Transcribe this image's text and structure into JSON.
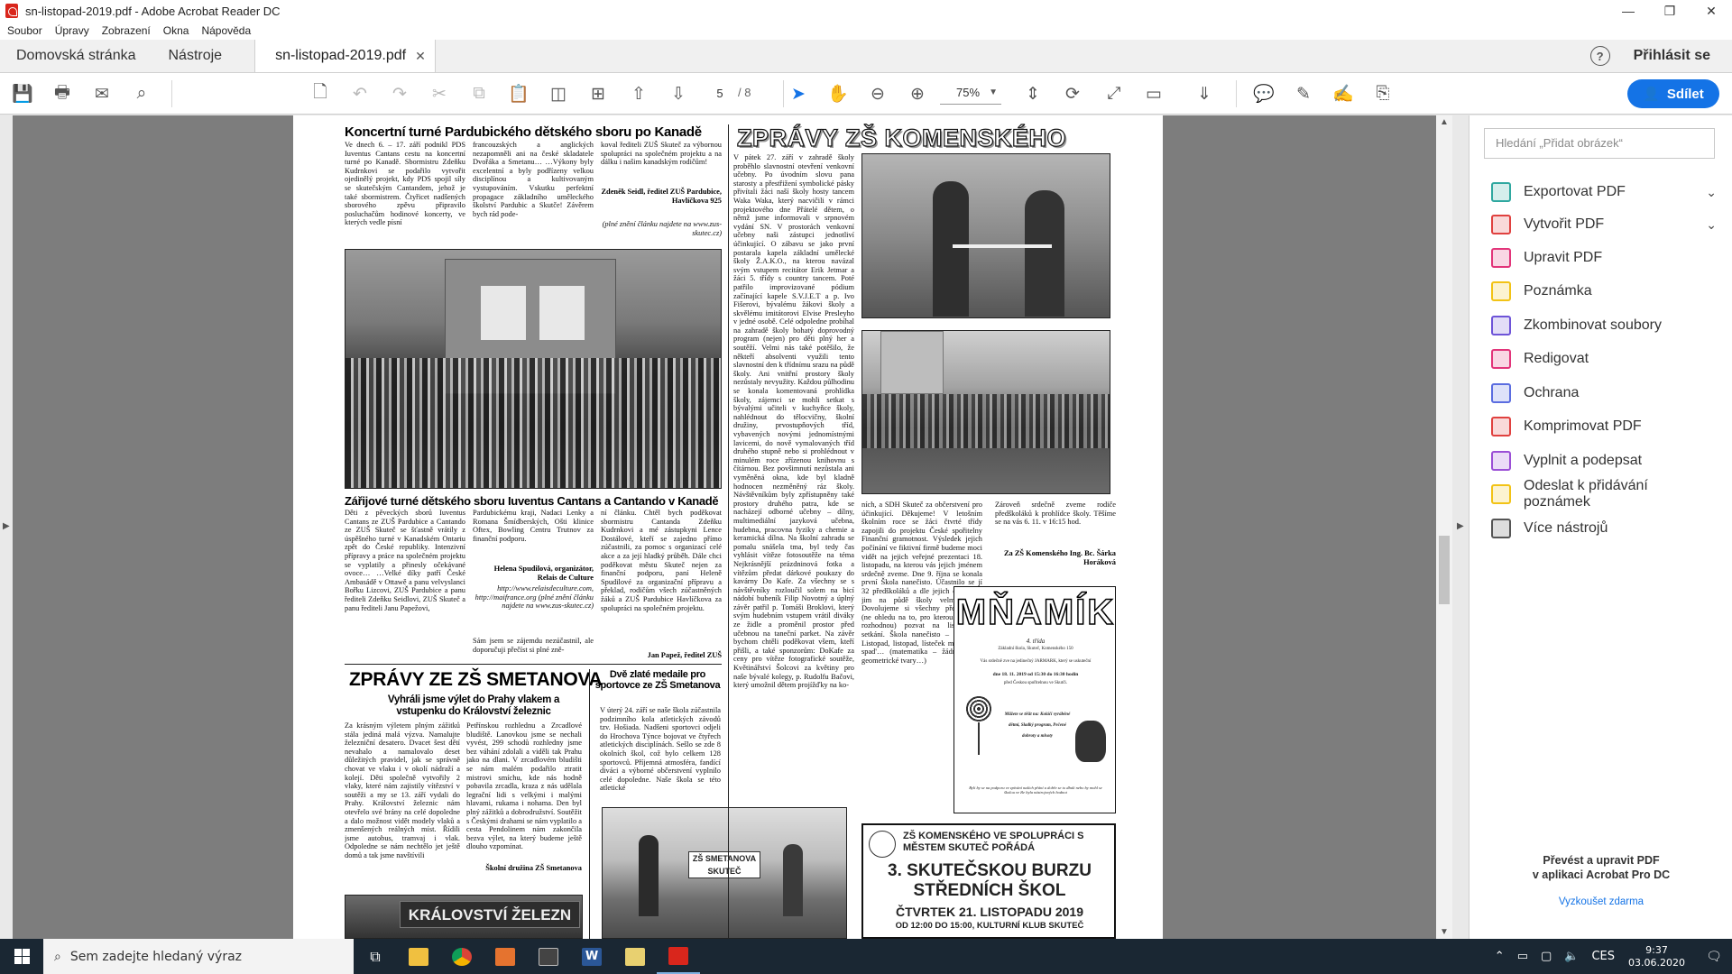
{
  "window": {
    "title": "sn-listopad-2019.pdf - Adobe Acrobat Reader DC",
    "minimize": "—",
    "maximize": "❐",
    "close": "✕"
  },
  "menu": [
    "Soubor",
    "Úpravy",
    "Zobrazení",
    "Okna",
    "Nápověda"
  ],
  "tabs": {
    "home": "Domovská stránka",
    "tools": "Nástroje",
    "document": "sn-listopad-2019.pdf",
    "help": "?",
    "signin": "Přihlásit se"
  },
  "toolbar": {
    "page_current": "5",
    "page_total": "/ 8",
    "zoom": "75%",
    "share_label": "Sdílet"
  },
  "right_panel": {
    "search_placeholder": "Hledání „Přidat obrázek“",
    "tools": [
      {
        "label": "Exportovat PDF",
        "color": "#2fa8a0",
        "expandable": true
      },
      {
        "label": "Vytvořit PDF",
        "color": "#e0413f",
        "expandable": true
      },
      {
        "label": "Upravit PDF",
        "color": "#e2357a"
      },
      {
        "label": "Poznámka",
        "color": "#f2c316"
      },
      {
        "label": "Zkombinovat soubory",
        "color": "#6e54d8"
      },
      {
        "label": "Redigovat",
        "color": "#e2357a"
      },
      {
        "label": "Ochrana",
        "color": "#5b6de0"
      },
      {
        "label": "Komprimovat PDF",
        "color": "#e0413f"
      },
      {
        "label": "Vyplnit a podepsat",
        "color": "#9b4fd6"
      },
      {
        "label": "Odeslat k přidávání poznámek",
        "color": "#f2c316"
      },
      {
        "label": "Více nástrojů",
        "color": "#555555"
      }
    ],
    "promo_line1": "Převést a upravit PDF",
    "promo_line2": "v aplikaci Acrobat Pro DC",
    "try_free": "Vyzkoušet zdarma"
  },
  "newspaper": {
    "a1_title": "Koncertní turné Pardubického dětského sboru po Kanadě",
    "a1_col1": "Ve dnech 6. – 17. září podnikl PDS Iuventus Cantans cestu na koncertní turné po Kanadě. Sbormistru Zdeňku Kudrnkovi se podařilo vytvořit ojedinělý projekt, kdy PDS spojil síly se skutečským Cantandem, jehož je také sbormistrem. Čtyřicet nadšených sborového zpěvu připravilo posluchačům hodinové koncerty, ve kterých vedle písní",
    "a1_col2": "francouzských a anglických nezapomněli ani na české skladatele Dvořáka a Smetanu… …Výkony byly excelentní a byly podřízeny velkou disciplínou a kultivovaným vystupováním. Vskutku perfektní propagace základního uměleckého školství Pardubic a Skutče! Závěrem bych rád pode-",
    "a1_col3": "koval řediteli ZUŠ Skuteč za výbornou spolupráci na společném projektu a na dálku i našim kanadským rodičům!",
    "a1_sig": "Zdeněk Seidl, ředitel ZUŠ Pardubice, Havlíčkova 925",
    "a1_src": "(plné znění článku najdete na www.zus-skutec.cz)",
    "a2_title": "Zářijové turné dětského sboru Iuventus Cantans a Cantando v Kanadě",
    "a2_col1": "Děti z pěveckých sborů Iuventus Cantans ze ZUŠ Pardubice a Cantando ze ZUŠ Skuteč se šťastně vrátily z úspěšného turné v Kanadském Ontariu zpět do České republiky. Intenzivní přípravy a práce na společném projektu se vyplatily a přinesly očekávané ovoce… …Velké díky patří České Ambasádě v Ottawě a panu velvyslanci Bořku Lizcovi, ZUŠ Pardubice a panu řediteli Zdeňku Seidlovi, ZUŠ Skuteč a panu řediteli Janu Papežovi,",
    "a2_col2": "Pardubickému kraji, Nadaci Lenky a Romana Šmídberských, Ošti klinice Oftex, Bowling Centru Trutnov za finanční podporu.",
    "a2_sig": "Helena Spudilová, organizátor, Relais de Culture",
    "a2_src": "http://www.relaisdeculture.com, http://maifrance.org (plné znění článku najdete na www.zus-skutec.cz)",
    "a2_col2b": "Sám jsem se zájemdu nezúčastnil, ale doporučuji přečíst si plné zně-",
    "a2_col3": "ní článku. Chtěl bych poděkovat sbormistru Cantanda Zdeňku Kudrnkovi a mé zástupkyni Lence Dostálové, kteří se zajedno přímo zúčastnili, za pomoc s organizací celé akce a za její hladký průběh. Dále chci poděkovat městu Skuteč nejen za finanční podporu, paní Heleně Spudilové za organizační přípravu a překlad, rodičům všech zúčastněných žáků a ZUŠ Pardubice Havlíčkova za spolupráci na společném projektu.",
    "a2_sig2": "Jan Papež, ředitel ZUŠ",
    "smetanova_head": "ZPRÁVY ZE ZŠ SMETANOVA",
    "a3_title": "Vyhráli jsme výlet do Prahy vlakem a vstupenku do Království železnic",
    "a3_col1": "Za krásným výletem plným zážitků stála jediná malá výzva. Namalujte železniční desatero. Dvacet šest dětí nevahalo a namalovalo deset důležitých pravidel, jak se správně chovat ve vlaku i v okolí nádraží a kolejí. Děti společně vytvořily 2 vlaky, které nám zajistily vítězství v soutěži a my se 13. září vydali do Prahy. Království železnic nám otevřelo své brány na celé dopoledne a dalo možnost vidět modely vlaků a zmenšených reálných míst. Řídili jsme autobus, tramvaj i vlak. Odpoledne se nám nechtělo jet ještě domů a tak jsme navštívili",
    "a3_col2": "Petřínskou rozhlednu a Zrcadlové bludiště. Lanovkou jsme se nechali vyvést, 299 schodů rozhledny jsme bez váhání zdolali a viděli tak Prahu jako na dlani. V zrcadlovém bludišti se nám malém podařilo ztratit mistrovi smíchu, kde nás hodně pobavila zrcadla, kraza z nás udělala legrační lidi s velkými i malými hlavami, rukama i nohama. Den byl plný zážitků a dobrodružství. Soutěžit s Českými drahami se nám vyplatilo a cesta Pendolinem nám zakončila bezva výlet, na který budeme ještě dlouho vzpomínat.",
    "a3_sig": "Školní družina ZŠ Smetanova",
    "a4_title": "Dvě zlaté medaile pro sportovce ze ZŠ Smetanova",
    "a4_col": "V úterý 24. září se naše škola zúčastnila podzimního kola atletických závodů tzv. Hošiada. Nadšeni sportovci odjeli do Hrochova Týnce bojovat ve čtyřech atletických disciplínách. Sešlo se zde 8 okolních škol, což bylo celkem 128 sportovců. Příjemná atmosféra, fandící diváci a výborné občerstvení vyplnilo celé dopoledne. Naše škola se této atletické",
    "banner_text": "KRÁLOVSTVÍ ŽELEZN",
    "photo_sign": "ZŠ SMETANOVA SKUTEČ",
    "komenskeho_head": "ZPRÁVY ZŠ KOMENSKÉHO",
    "k_col1": "V pátek 27. září v zahradě školy proběhlo slavnostní otevření venkovní učebny. Po úvodním slovu pana starosty a přestřižení symbolické pásky přivítali žáci naší školy hosty tancem Waka Waka, který nacvičili v rámci projektového dne Přátelé dětem, o němž jsme informovali v srpnovém vydání SN. V prostorách venkovní učebny naši zástupci jednotliví účinkující. O zábavu se jako první postarala kapela základní umělecké školy Ž.A.K.O., na kterou navázal svým vstupem recitátor Erik Jetmar a žáci 5. třídy s country tancem. Poté patřilo improvizované pódium začínající kapele S.V.J.E.T a p. Ivo Fišerovi, bývalému žákovi školy a skvělému imitátorovi Elvise Presleyho v jedné osobě. Celé odpoledne probíhal na zahradě školy bohatý doprovodný program (nejen) pro děti plný her a soutěží. Velmi nás také potěšilo, že někteří absolventi využili tento slavnostní den k třídnímu srazu na půdě školy. Ani vnitřní prostory školy nezůstaly nevyužity. Každou půlhodinu se konala komentovaná prohlídka školy, zájemci se mohli setkat s bývalými učiteli v kuchyňce školy, nahlédnout do tělocvičny, školní družiny, prvostupňových tříd, vybavených novými jednomístnými lavicemi, do nově vymalovaných tříd druhého stupně nebo si prohlédnout v minulém roce zřízenou knihovnu s čítárnou. Bez povšimnutí nezůstala ani vyměněná okna, kde byl kladně hodnocen nezměněný ráz školy. Návštěvníkům byly zpřístupněny také prostory druhého patra, kde se nacházejí odborné učebny – dílny, multimediální jazyková učebna, hudebna, pracovna fyziky a chemie a keramická dílna. Na školní zahradu se pomalu snášela tma, byl tedy čas vyhlásit vítěze fotosoutěže na téma Nejkrásnější prázdninová fotka a vítězům předat dárkové poukazy do kavárny Do Kafe. Za všechny se s návštěvníky rozloučil solem na bicí nádobí bubeník Filip Novotný a úplný závěr patřil p. Tomáši Broklovi, který svým hudebním vstupem vrátil diváky ze židle a proměnil prostor před učebnou na taneční parket. Na závěr bychom chtěli poděkovat všem, kteří přišli, a také sponzorům: DoKafe za ceny pro vítěze fotografické soutěže, Květinářství Šolcovi za květiny pro naše bývalé kolegy, p. Rudolfu Bačovi, který umožnil dětem projížďky na ko-",
    "k_col2": "ních, a SDH Skuteč za občerstvení pro účinkující. Děkujeme! V letošním školním roce se žáci čtvrté třídy zapojili do projektu České spořitelny Finanční gramotnost. Výsledek jejich počínání ve fiktivní firmě budeme moci vidět na jejich veřejné prezentaci 18. listopadu, na kterou vás jejich jménem srdečně zveme. Dne 9. října se konala první Škola nanečisto. Účastnilo se jí 32 předškoláků a dle jejich ohlasů se jim na půdě školy velmi líbilo. Dovolujeme si všechny předškoláky (ne ohledu na to, pro kterou školu se rozhodnou) pozvat na listopadové setkání. Škola nanečisto – 6. 11. – Listopad, listopad, lísteček mi na dlaň spad'… (matematika – žádná dřina, geometrické tvary…)",
    "k_col3": "Zároveň srdečně zveme rodiče předškoláků k prohlídce školy. Těšíme se na vás 6. 11. v 16:15 hod.",
    "k_sig": "Za ZŠ Komenského Ing. Bc. Šárka Horáková",
    "poster1_title": "MŇAMÍK",
    "poster1_sub": "4. třída",
    "poster1_school": "Základní škola, Skuteč, Komenského 150",
    "poster1_inv": "Vás srdečně zve na jedinečný JARMARK, který se uskuteční",
    "poster1_date": "dne 18. 11. 2019 od 15:30 do 16:30 hodin",
    "poster1_place": "před Českou spořitelnou ve Skutči.",
    "poster1_items": "Můžete se těšit na: Koláčí vyráběné dětmi, Sladký program, Pečené dobroty a mlsoty",
    "poster1_foot": "Byli by se na podporu ve zpívání našich přání a dobře se to dbali nebo by mohl se školou ve žle byla nástrojových hodnot",
    "poster2_line1": "ZŠ KOMENSKÉHO VE SPOLUPRÁCI S MĚSTEM SKUTEČ POŘÁDÁ",
    "poster2_title": "3. SKUTEČSKOU BURZU STŘEDNÍCH ŠKOL",
    "poster2_date": "ČTVRTEK 21. LISTOPADU 2019",
    "poster2_time": "OD 12:00 DO 15:00, KULTURNÍ KLUB SKUTEČ"
  },
  "taskbar": {
    "search_placeholder": "Sem zadejte hledaný výraz",
    "language": "CES",
    "time": "9:37",
    "date": "03.06.2020"
  }
}
